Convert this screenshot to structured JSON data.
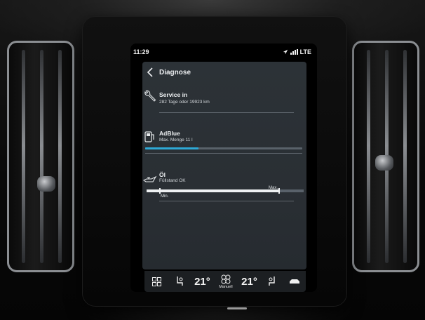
{
  "status_bar": {
    "time": "11:29",
    "network": "LTE"
  },
  "header": {
    "title": "Diagnose"
  },
  "service": {
    "title": "Service in",
    "detail": "282 Tage oder 19923 km"
  },
  "adblue": {
    "title": "AdBlue",
    "detail": "Max. Menge 11 l",
    "level": 0.34
  },
  "oil": {
    "title": "Öl",
    "detail": "Füllstand OK",
    "min_label": "Min.",
    "max_label": "Max.",
    "level": 0.85
  },
  "climate": {
    "driver_temp": "21°",
    "passenger_temp": "21°",
    "fan_label": "Manuell"
  },
  "colors": {
    "accent": "#2ea9d6",
    "panel": "#2c3237"
  },
  "icons": [
    "back-chevron-icon",
    "wrench-icon",
    "adblue-pump-icon",
    "oil-can-icon",
    "grid-icon",
    "seat-heat-left-icon",
    "fan-icon",
    "seat-heat-right-icon",
    "car-icon",
    "location-arrow-icon",
    "signal-icon"
  ]
}
